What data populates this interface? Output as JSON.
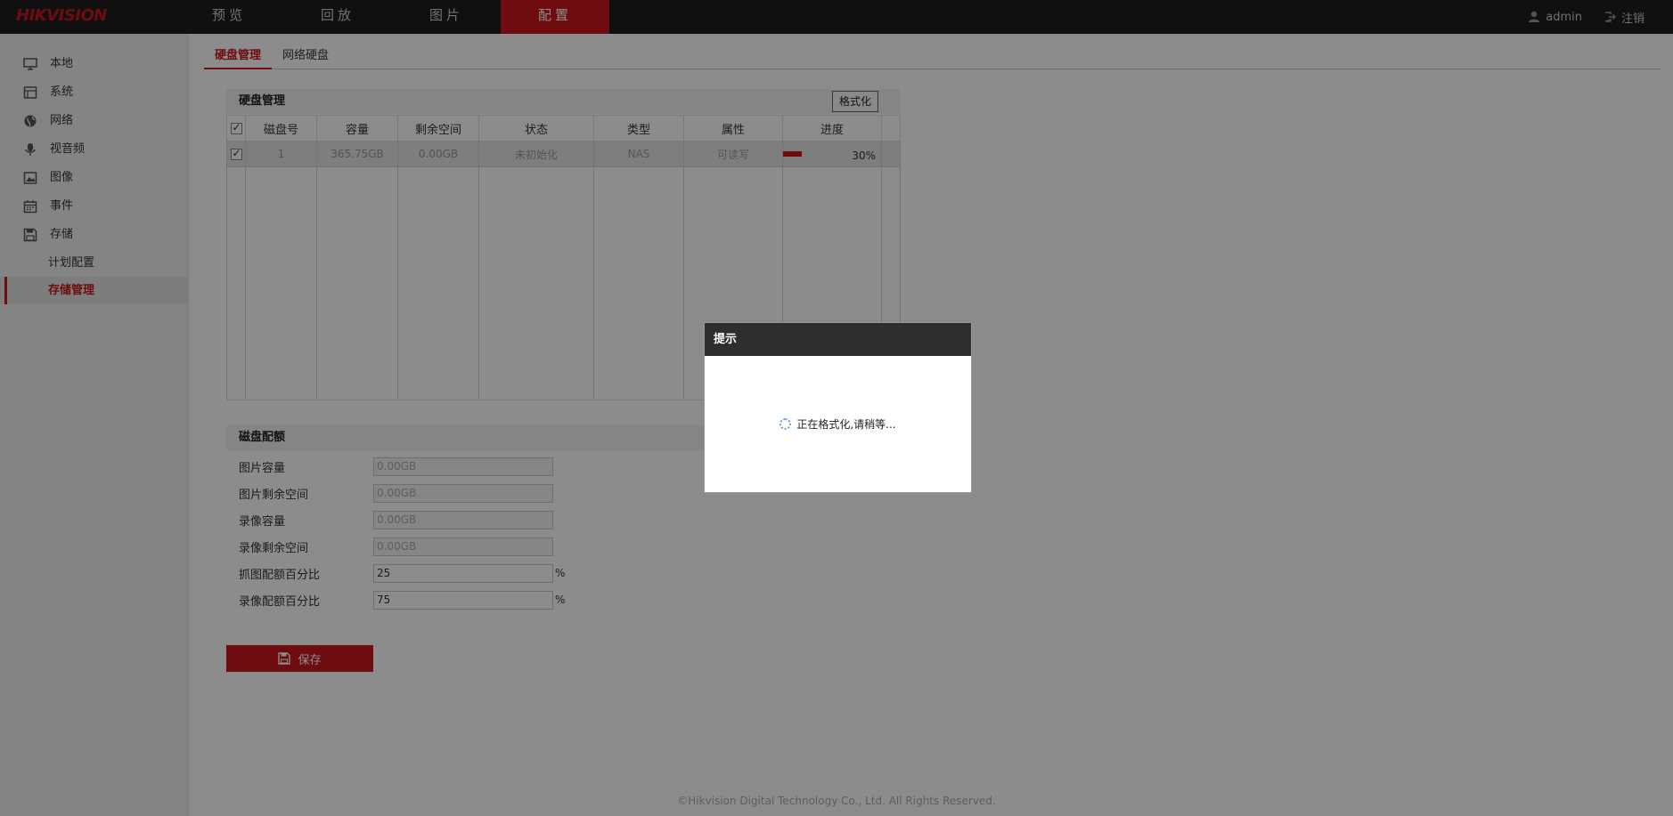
{
  "brand": {
    "logo_text": "HIKVISION",
    "accent_color": "#c8161d"
  },
  "topnav": {
    "items": [
      {
        "label": "预览"
      },
      {
        "label": "回放"
      },
      {
        "label": "图片"
      },
      {
        "label": "配置"
      }
    ],
    "active": "配置",
    "user_icon": "user-icon",
    "username": "admin",
    "logout_icon": "logout-icon",
    "logout_label": "注销"
  },
  "sidebar": {
    "items": [
      {
        "label": "本地",
        "icon": "monitor-icon"
      },
      {
        "label": "系统",
        "icon": "system-icon"
      },
      {
        "label": "网络",
        "icon": "globe-icon"
      },
      {
        "label": "视音频",
        "icon": "microphone-icon"
      },
      {
        "label": "图像",
        "icon": "image-icon"
      },
      {
        "label": "事件",
        "icon": "calendar-icon"
      },
      {
        "label": "存储",
        "icon": "save-disk-icon"
      }
    ],
    "subitems": [
      {
        "label": "计划配置"
      },
      {
        "label": "存储管理"
      }
    ],
    "active_sub": "存储管理"
  },
  "tabs": [
    {
      "label": "硬盘管理"
    },
    {
      "label": "网络硬盘"
    }
  ],
  "disk_section": {
    "title": "硬盘管理",
    "format_button": "格式化",
    "columns": [
      "磁盘号",
      "容量",
      "剩余空间",
      "状态",
      "类型",
      "属性",
      "进度"
    ],
    "rows": [
      {
        "disk_no": "1",
        "capacity": "365.75GB",
        "free": "0.00GB",
        "status": "未初始化",
        "type": "NAS",
        "attribute": "可读写",
        "progress_percent": 30,
        "progress_text": "30%"
      }
    ]
  },
  "quota_section": {
    "title": "磁盘配额",
    "fields": [
      {
        "label": "图片容量",
        "value": "0.00GB"
      },
      {
        "label": "图片剩余空间",
        "value": "0.00GB"
      },
      {
        "label": "录像容量",
        "value": "0.00GB"
      },
      {
        "label": "录像剩余空间",
        "value": "0.00GB"
      },
      {
        "label": "抓图配额百分比",
        "value": "25",
        "unit": "%"
      },
      {
        "label": "录像配额百分比",
        "value": "75",
        "unit": "%"
      }
    ]
  },
  "save_button": {
    "label": "保存",
    "icon": "floppy-icon"
  },
  "footer": "©Hikvision Digital Technology Co., Ltd. All Rights Reserved.",
  "dialog": {
    "title": "提示",
    "message": "正在格式化,请稍等...",
    "icon": "spinner-icon"
  }
}
